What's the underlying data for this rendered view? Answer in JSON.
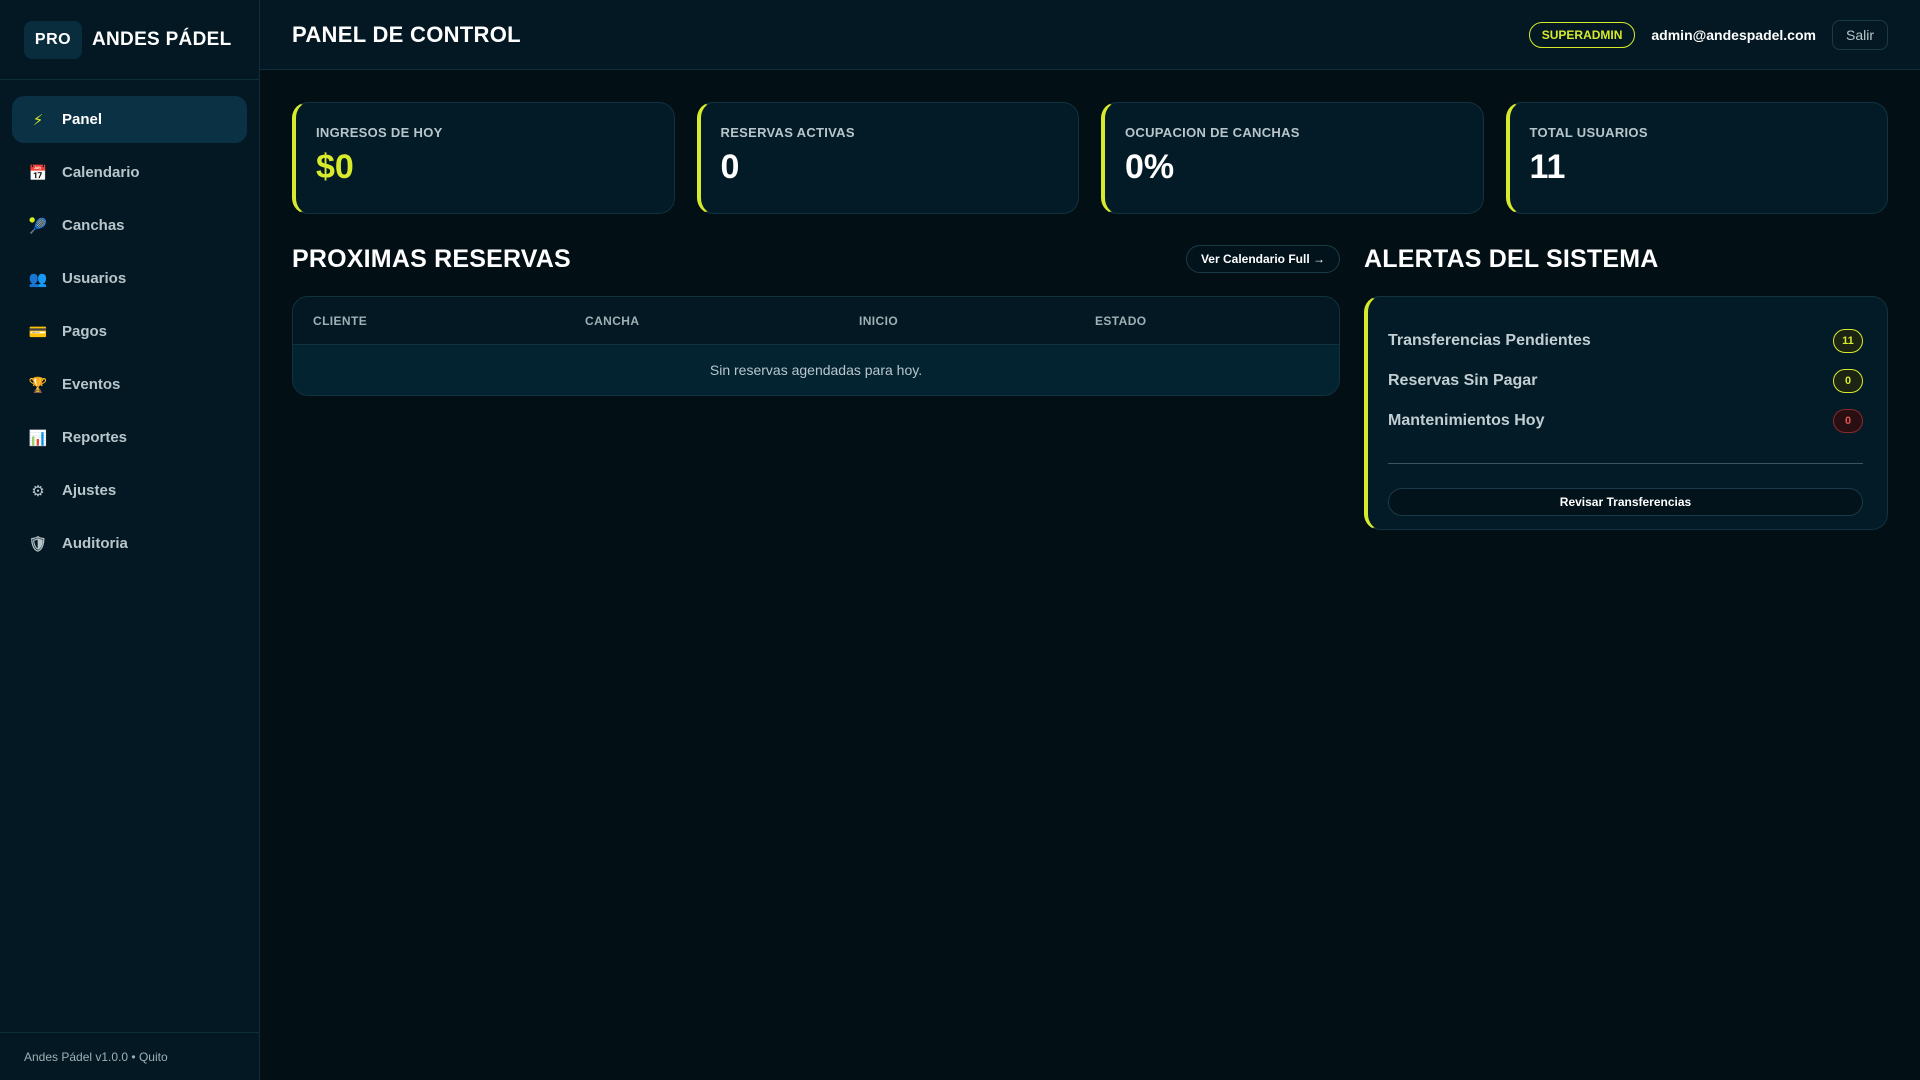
{
  "brand": {
    "badge": "PRO",
    "name": "ANDES PÁDEL"
  },
  "sidebar": {
    "items": [
      {
        "label": "Panel",
        "icon": "⚡",
        "active": true
      },
      {
        "label": "Calendario",
        "icon": "📅"
      },
      {
        "label": "Canchas",
        "icon": "🎾"
      },
      {
        "label": "Usuarios",
        "icon": "👥"
      },
      {
        "label": "Pagos",
        "icon": "💳"
      },
      {
        "label": "Eventos",
        "icon": "🏆"
      },
      {
        "label": "Reportes",
        "icon": "📊"
      },
      {
        "label": "Ajustes",
        "icon": "⚙"
      },
      {
        "label": "Auditoria",
        "icon": "🛡"
      }
    ],
    "footer": "Andes Pádel v1.0.0 • Quito"
  },
  "topbar": {
    "title": "PANEL DE CONTROL",
    "role": "SUPERADMIN",
    "email": "admin@andespadel.com",
    "logout": "Salir"
  },
  "stats": [
    {
      "label": "INGRESOS DE HOY",
      "value": "$0"
    },
    {
      "label": "RESERVAS ACTIVAS",
      "value": "0"
    },
    {
      "label": "OCUPACION DE CANCHAS",
      "value": "0%"
    },
    {
      "label": "TOTAL USUARIOS",
      "value": "11"
    }
  ],
  "reservas": {
    "title": "PROXIMAS RESERVAS",
    "link": "Ver Calendario Full →",
    "columns": [
      "CLIENTE",
      "CANCHA",
      "INICIO",
      "ESTADO"
    ],
    "empty": "Sin reservas agendadas para hoy."
  },
  "alertas": {
    "title": "ALERTAS DEL SISTEMA",
    "items": [
      {
        "label": "Transferencias Pendientes",
        "count": "11"
      },
      {
        "label": "Reservas Sin Pagar",
        "count": "0"
      },
      {
        "label": "Mantenimientos Hoy",
        "count": "0"
      }
    ],
    "button": "Revisar Transferencias"
  },
  "colors": {
    "accent": "#d7ea2c",
    "danger": "#e05555",
    "background": "#020f15"
  }
}
